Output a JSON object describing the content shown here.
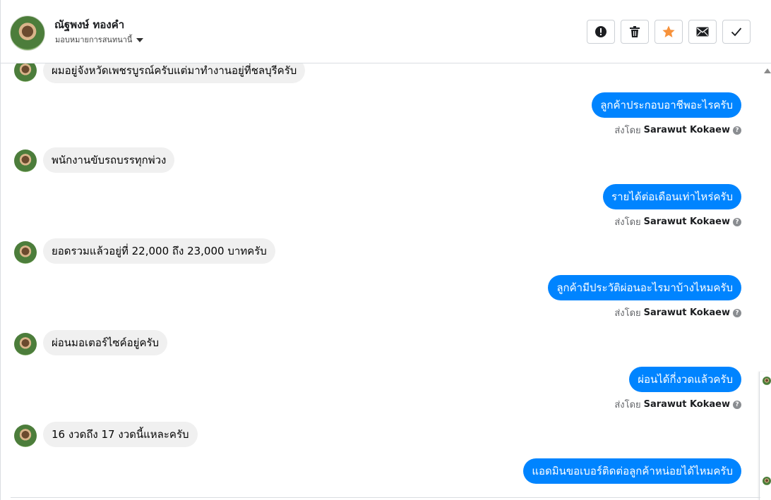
{
  "header": {
    "contact_name": "ณัฐพงษ์ ทองคำ",
    "assignment_label": "มอบหมายการสนทนานี้",
    "actions": [
      {
        "name": "report-button",
        "icon": "alert-icon"
      },
      {
        "name": "delete-button",
        "icon": "trash-icon"
      },
      {
        "name": "star-button",
        "icon": "star-icon"
      },
      {
        "name": "mark-unread-button",
        "icon": "envelope-icon"
      },
      {
        "name": "mark-done-button",
        "icon": "check-icon"
      }
    ]
  },
  "messages": [
    {
      "direction": "in",
      "text": "ผมอยู่จังหวัดเพชรบูรณ์ครับแต่มาทำงานอยู่ที่ชลบุรีครับ"
    },
    {
      "direction": "out",
      "text": "ลูกค้าประกอบอาชีพอะไรครับ",
      "sent_by_label": "ส่งโดย",
      "sender": "Sarawut Kokaew"
    },
    {
      "direction": "in",
      "text": "พนักงานขับรถบรรทุกพ่วง"
    },
    {
      "direction": "out",
      "text": "รายได้ต่อเดือนเท่าไหร่ครับ",
      "sent_by_label": "ส่งโดย",
      "sender": "Sarawut Kokaew"
    },
    {
      "direction": "in",
      "text": "ยอดรวมแล้วอยู่ที่ 22,000 ถึง 23,000 บาทครับ"
    },
    {
      "direction": "out",
      "text": "ลูกค้ามีประวัติผ่อนอะไรมาบ้างไหมครับ",
      "sent_by_label": "ส่งโดย",
      "sender": "Sarawut Kokaew"
    },
    {
      "direction": "in",
      "text": "ผ่อนมอเตอร์ไซค์อยู่ครับ"
    },
    {
      "direction": "out",
      "text": "ผ่อนได้กี่งวดแล้วครับ",
      "sent_by_label": "ส่งโดย",
      "sender": "Sarawut Kokaew"
    },
    {
      "direction": "in",
      "text": "16 งวดถึง 17 งวดนี้แหละครับ"
    },
    {
      "direction": "out",
      "text": "แอดมินขอเบอร์ติดต่อลูกค้าหน่อยได้ไหมครับ"
    }
  ],
  "colors": {
    "outgoing_bubble": "#0084ff",
    "incoming_bubble": "#f0f0f0",
    "star_accent": "#f7923b"
  }
}
